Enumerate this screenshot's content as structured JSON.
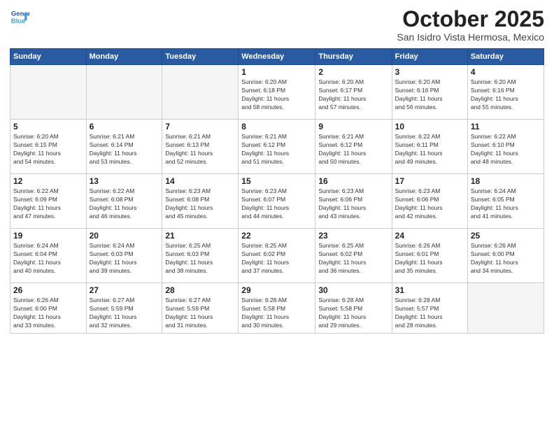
{
  "logo": {
    "line1": "General",
    "line2": "Blue"
  },
  "title": "October 2025",
  "subtitle": "San Isidro Vista Hermosa, Mexico",
  "weekdays": [
    "Sunday",
    "Monday",
    "Tuesday",
    "Wednesday",
    "Thursday",
    "Friday",
    "Saturday"
  ],
  "weeks": [
    [
      {
        "day": "",
        "info": ""
      },
      {
        "day": "",
        "info": ""
      },
      {
        "day": "",
        "info": ""
      },
      {
        "day": "1",
        "info": "Sunrise: 6:20 AM\nSunset: 6:18 PM\nDaylight: 11 hours\nand 58 minutes."
      },
      {
        "day": "2",
        "info": "Sunrise: 6:20 AM\nSunset: 6:17 PM\nDaylight: 11 hours\nand 57 minutes."
      },
      {
        "day": "3",
        "info": "Sunrise: 6:20 AM\nSunset: 6:16 PM\nDaylight: 11 hours\nand 56 minutes."
      },
      {
        "day": "4",
        "info": "Sunrise: 6:20 AM\nSunset: 6:16 PM\nDaylight: 11 hours\nand 55 minutes."
      }
    ],
    [
      {
        "day": "5",
        "info": "Sunrise: 6:20 AM\nSunset: 6:15 PM\nDaylight: 11 hours\nand 54 minutes."
      },
      {
        "day": "6",
        "info": "Sunrise: 6:21 AM\nSunset: 6:14 PM\nDaylight: 11 hours\nand 53 minutes."
      },
      {
        "day": "7",
        "info": "Sunrise: 6:21 AM\nSunset: 6:13 PM\nDaylight: 11 hours\nand 52 minutes."
      },
      {
        "day": "8",
        "info": "Sunrise: 6:21 AM\nSunset: 6:12 PM\nDaylight: 11 hours\nand 51 minutes."
      },
      {
        "day": "9",
        "info": "Sunrise: 6:21 AM\nSunset: 6:12 PM\nDaylight: 11 hours\nand 50 minutes."
      },
      {
        "day": "10",
        "info": "Sunrise: 6:22 AM\nSunset: 6:11 PM\nDaylight: 11 hours\nand 49 minutes."
      },
      {
        "day": "11",
        "info": "Sunrise: 6:22 AM\nSunset: 6:10 PM\nDaylight: 11 hours\nand 48 minutes."
      }
    ],
    [
      {
        "day": "12",
        "info": "Sunrise: 6:22 AM\nSunset: 6:09 PM\nDaylight: 11 hours\nand 47 minutes."
      },
      {
        "day": "13",
        "info": "Sunrise: 6:22 AM\nSunset: 6:08 PM\nDaylight: 11 hours\nand 46 minutes."
      },
      {
        "day": "14",
        "info": "Sunrise: 6:23 AM\nSunset: 6:08 PM\nDaylight: 11 hours\nand 45 minutes."
      },
      {
        "day": "15",
        "info": "Sunrise: 6:23 AM\nSunset: 6:07 PM\nDaylight: 11 hours\nand 44 minutes."
      },
      {
        "day": "16",
        "info": "Sunrise: 6:23 AM\nSunset: 6:06 PM\nDaylight: 11 hours\nand 43 minutes."
      },
      {
        "day": "17",
        "info": "Sunrise: 6:23 AM\nSunset: 6:06 PM\nDaylight: 11 hours\nand 42 minutes."
      },
      {
        "day": "18",
        "info": "Sunrise: 6:24 AM\nSunset: 6:05 PM\nDaylight: 11 hours\nand 41 minutes."
      }
    ],
    [
      {
        "day": "19",
        "info": "Sunrise: 6:24 AM\nSunset: 6:04 PM\nDaylight: 11 hours\nand 40 minutes."
      },
      {
        "day": "20",
        "info": "Sunrise: 6:24 AM\nSunset: 6:03 PM\nDaylight: 11 hours\nand 39 minutes."
      },
      {
        "day": "21",
        "info": "Sunrise: 6:25 AM\nSunset: 6:03 PM\nDaylight: 11 hours\nand 38 minutes."
      },
      {
        "day": "22",
        "info": "Sunrise: 6:25 AM\nSunset: 6:02 PM\nDaylight: 11 hours\nand 37 minutes."
      },
      {
        "day": "23",
        "info": "Sunrise: 6:25 AM\nSunset: 6:02 PM\nDaylight: 11 hours\nand 36 minutes."
      },
      {
        "day": "24",
        "info": "Sunrise: 6:26 AM\nSunset: 6:01 PM\nDaylight: 11 hours\nand 35 minutes."
      },
      {
        "day": "25",
        "info": "Sunrise: 6:26 AM\nSunset: 6:00 PM\nDaylight: 11 hours\nand 34 minutes."
      }
    ],
    [
      {
        "day": "26",
        "info": "Sunrise: 6:26 AM\nSunset: 6:00 PM\nDaylight: 11 hours\nand 33 minutes."
      },
      {
        "day": "27",
        "info": "Sunrise: 6:27 AM\nSunset: 5:59 PM\nDaylight: 11 hours\nand 32 minutes."
      },
      {
        "day": "28",
        "info": "Sunrise: 6:27 AM\nSunset: 5:59 PM\nDaylight: 11 hours\nand 31 minutes."
      },
      {
        "day": "29",
        "info": "Sunrise: 6:28 AM\nSunset: 5:58 PM\nDaylight: 11 hours\nand 30 minutes."
      },
      {
        "day": "30",
        "info": "Sunrise: 6:28 AM\nSunset: 5:58 PM\nDaylight: 11 hours\nand 29 minutes."
      },
      {
        "day": "31",
        "info": "Sunrise: 6:28 AM\nSunset: 5:57 PM\nDaylight: 11 hours\nand 28 minutes."
      },
      {
        "day": "",
        "info": ""
      }
    ]
  ]
}
